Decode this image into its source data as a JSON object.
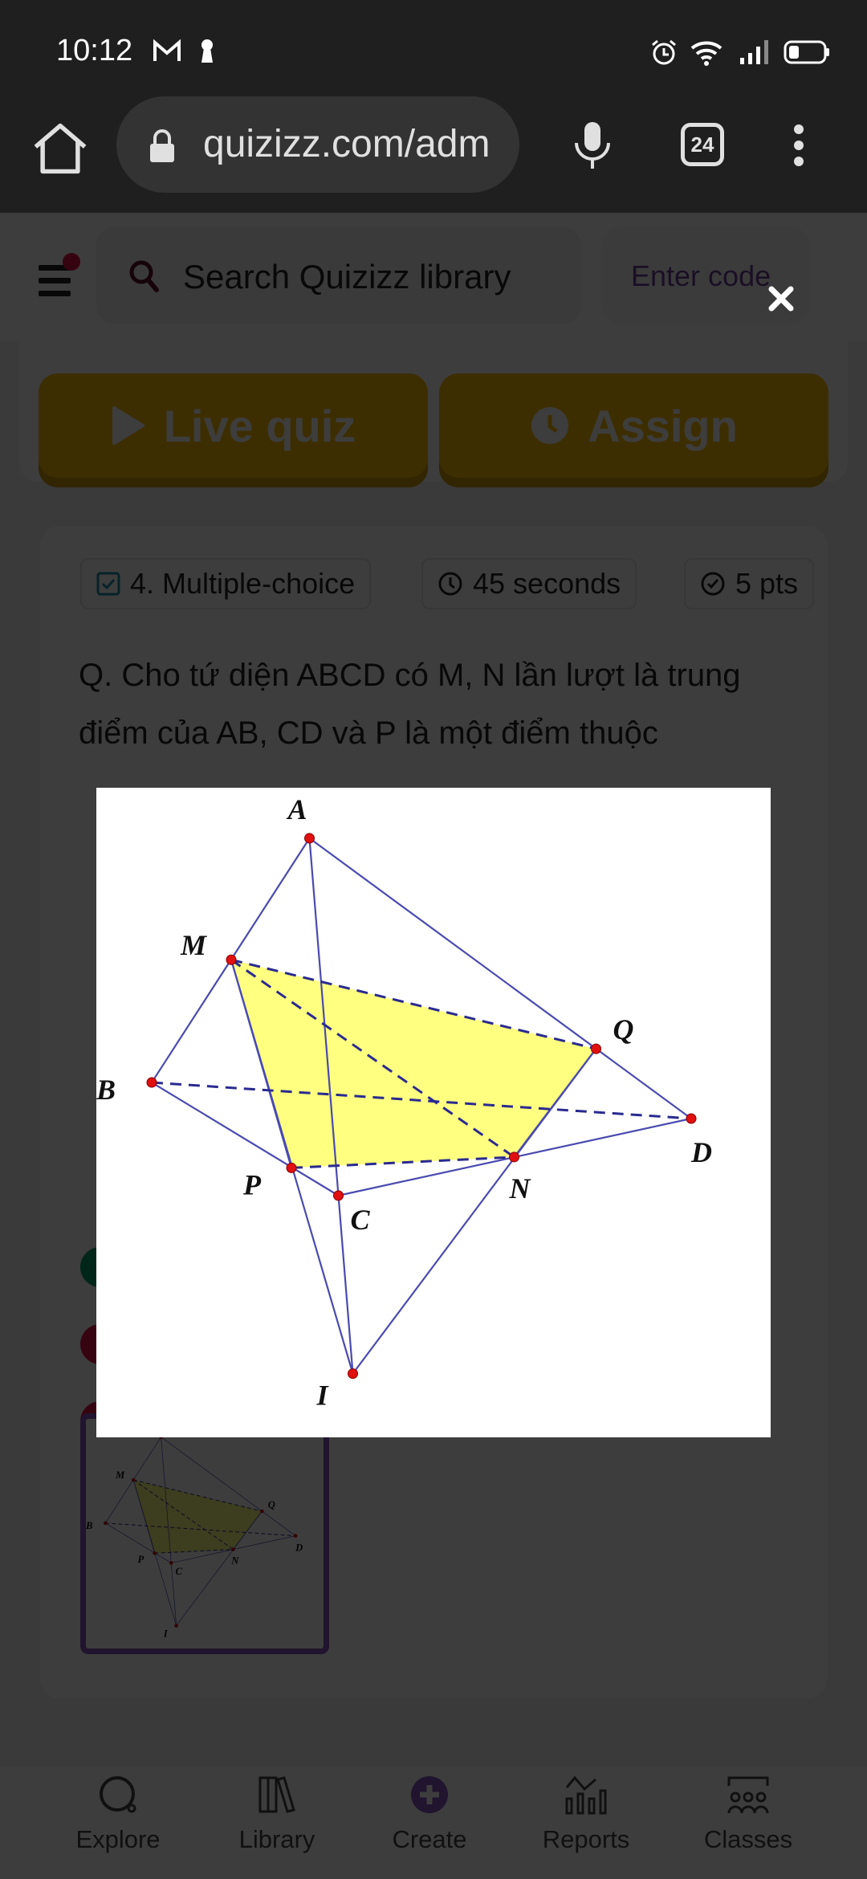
{
  "status_bar": {
    "time": "10:12",
    "left_icons": [
      "gmail-icon",
      "keyhole-icon"
    ],
    "right_icons": [
      "alarm-icon",
      "wifi-icon",
      "signal-icon",
      "battery-icon"
    ]
  },
  "browser": {
    "url": "quizizz.com/adm",
    "tab_count": "24"
  },
  "topbar": {
    "search_placeholder": "Search Quizizz library",
    "enter_code": "Enter code"
  },
  "actions": {
    "live_quiz": "Live quiz",
    "assign": "Assign"
  },
  "question": {
    "type_label": "4. Multiple-choice",
    "time_label": "45 seconds",
    "points_label": "5 pts",
    "text": "Q. Cho tứ diện ABCD có M, N  lần lượt là trung điểm của AB, CD và P là một điểm thuộc",
    "options": [
      {
        "status": "correct",
        "color": "#00a06a"
      },
      {
        "status": "incorrect",
        "color": "#e0144a"
      },
      {
        "status": "incorrect",
        "color": "#e0144a"
      },
      {
        "status": "incorrect",
        "color": "#e0144a"
      }
    ]
  },
  "figure": {
    "points": [
      {
        "label": "A"
      },
      {
        "label": "B"
      },
      {
        "label": "C"
      },
      {
        "label": "D"
      },
      {
        "label": "M"
      },
      {
        "label": "N"
      },
      {
        "label": "P"
      },
      {
        "label": "Q"
      },
      {
        "label": "I"
      }
    ],
    "fill_color": "#ffff80",
    "line_color": "#4a4ab0",
    "point_color": "#e01010"
  },
  "bottom_nav": [
    {
      "label": "Explore",
      "icon": "explore-icon"
    },
    {
      "label": "Library",
      "icon": "library-icon"
    },
    {
      "label": "Create",
      "icon": "create-plus-icon"
    },
    {
      "label": "Reports",
      "icon": "reports-icon"
    },
    {
      "label": "Classes",
      "icon": "classes-icon"
    }
  ],
  "modal": {
    "close_icon": "close-icon"
  }
}
